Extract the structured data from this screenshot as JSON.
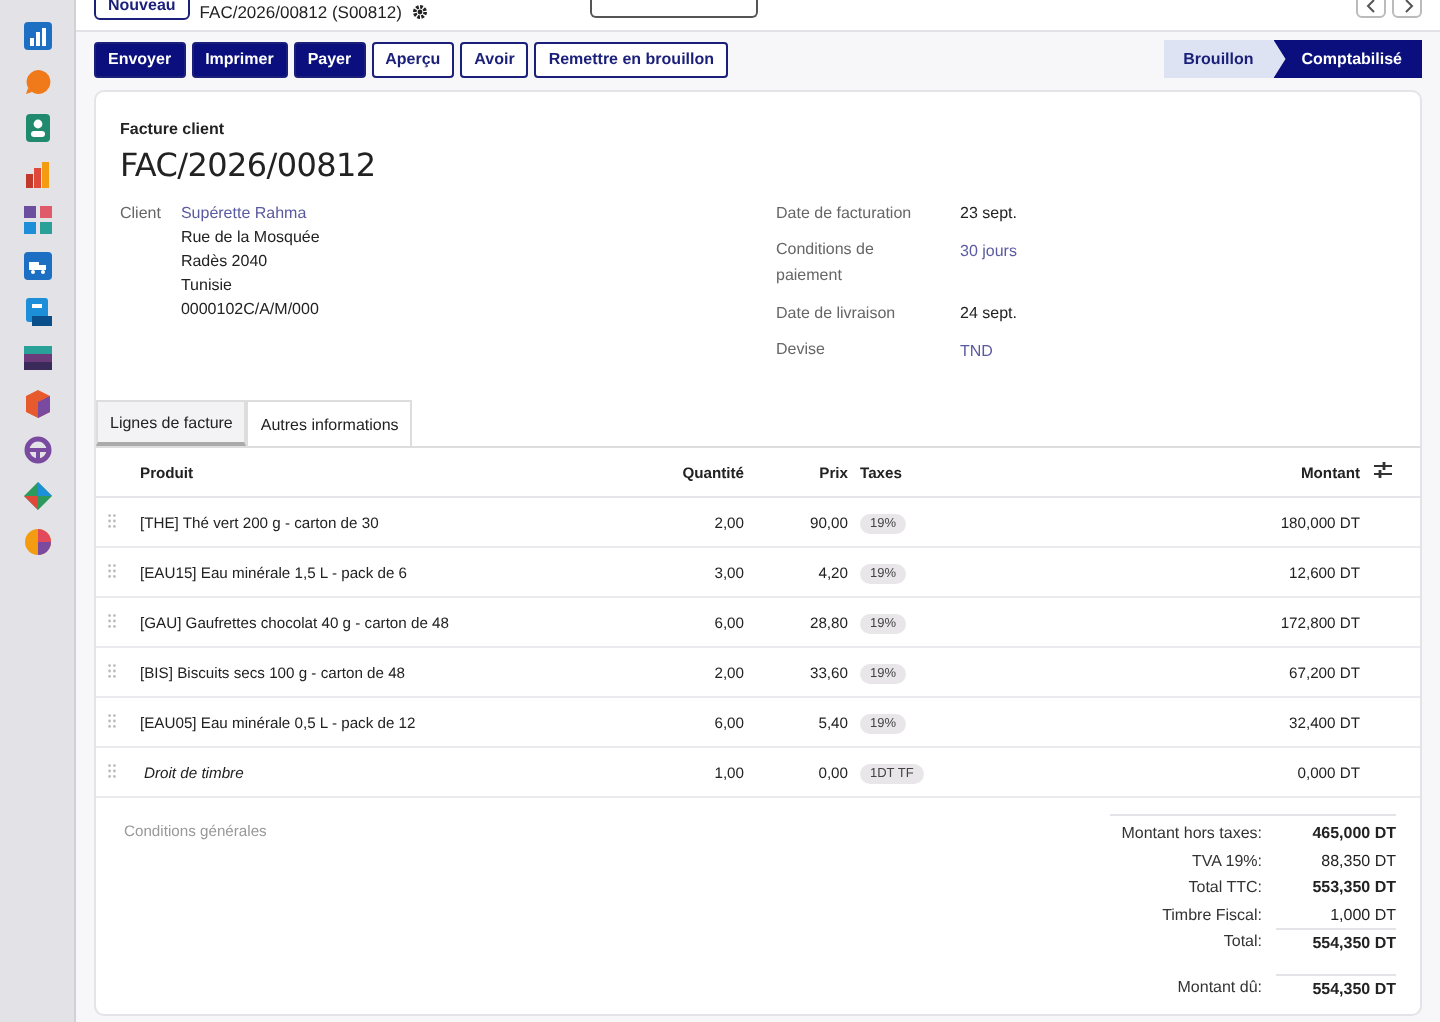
{
  "topbar": {
    "new_button": "Nouveau",
    "breadcrumb": "FAC/2026/00812 (S00812)"
  },
  "actions": [
    {
      "label": "Envoyer",
      "primary": true
    },
    {
      "label": "Imprimer",
      "primary": true
    },
    {
      "label": "Payer",
      "primary": true
    },
    {
      "label": "Aperçu",
      "primary": false
    },
    {
      "label": "Avoir",
      "primary": false
    },
    {
      "label": "Remettre en brouillon",
      "primary": false
    }
  ],
  "statuses": [
    {
      "label": "Brouillon",
      "selected": false
    },
    {
      "label": "Comptabilisé",
      "selected": true
    }
  ],
  "invoice": {
    "type_label": "Facture client",
    "number": "FAC/2026/00812"
  },
  "client": {
    "label": "Client",
    "name": "Supérette Rahma",
    "address": [
      "Rue de la Mosquée",
      "Radès 2040",
      "Tunisie",
      "0000102C/A/M/000"
    ]
  },
  "details": [
    {
      "label": "Date de facturation",
      "value": "23 sept.",
      "kind": "plain"
    },
    {
      "label": "Conditions de paiement",
      "value": "30 jours",
      "kind": "link"
    },
    {
      "label": "Date de livraison",
      "value": "24 sept.",
      "kind": "plain"
    },
    {
      "label": "Devise",
      "value": "TND",
      "kind": "link"
    }
  ],
  "tabs": [
    {
      "label": "Lignes de facture",
      "selected": true
    },
    {
      "label": "Autres informations",
      "selected": false
    }
  ],
  "table": {
    "columns": [
      "Produit",
      "Quantité",
      "Prix",
      "Taxes",
      "Montant"
    ],
    "rows": [
      {
        "kind": "product",
        "product": "[THE] Thé vert 200 g - carton de 30",
        "quantity": "2,00",
        "price": "90,00",
        "tax": "19%",
        "amount": "180,000 DT"
      },
      {
        "kind": "product",
        "product": "[EAU15] Eau minérale 1,5 L - pack de 6",
        "quantity": "3,00",
        "price": "4,20",
        "tax": "19%",
        "amount": "12,600 DT"
      },
      {
        "kind": "product",
        "product": "[GAU] Gaufrettes chocolat 40 g - carton de 48",
        "quantity": "6,00",
        "price": "28,80",
        "tax": "19%",
        "amount": "172,800 DT"
      },
      {
        "kind": "product",
        "product": "[BIS] Biscuits secs 100 g - carton de 48",
        "quantity": "2,00",
        "price": "33,60",
        "tax": "19%",
        "amount": "67,200 DT"
      },
      {
        "kind": "product",
        "product": "[EAU05] Eau minérale 0,5 L - pack de 12",
        "quantity": "6,00",
        "price": "5,40",
        "tax": "19%",
        "amount": "32,400 DT"
      },
      {
        "kind": "note",
        "product": "Droit de timbre",
        "quantity": "1,00",
        "price": "0,00",
        "tax": "1DT TF",
        "amount": "0,000 DT"
      }
    ]
  },
  "terms_placeholder": "Conditions générales",
  "totals": [
    {
      "label": "Montant hors taxes:",
      "value": "465,000 DT",
      "bold": true,
      "rule": false
    },
    {
      "label": "TVA 19%:",
      "value": "88,350 DT",
      "bold": false,
      "rule": false
    },
    {
      "label": "Total TTC:",
      "value": "553,350 DT",
      "bold": true,
      "rule": false
    },
    {
      "label": "Timbre Fiscal:",
      "value": "1,000 DT",
      "bold": false,
      "rule": false
    },
    {
      "label": "Total:",
      "value": "554,350 DT",
      "bold": true,
      "rule": true
    }
  ],
  "amount_due": {
    "label": "Montant dû:",
    "value": "554,350 DT"
  }
}
